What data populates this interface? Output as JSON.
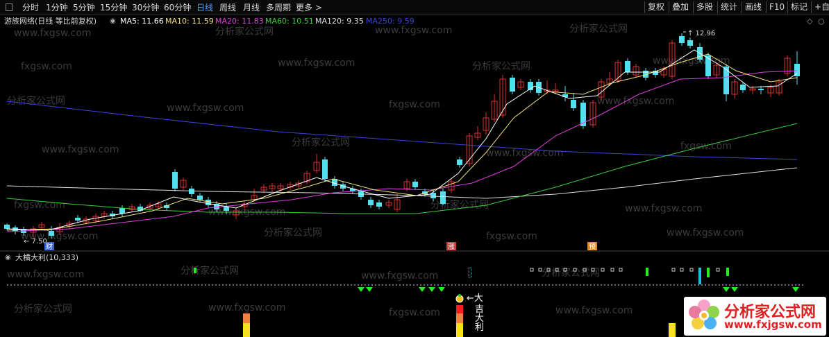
{
  "toolbar": {
    "periods": [
      "分时",
      "1分钟",
      "5分钟",
      "15分钟",
      "30分钟",
      "60分钟",
      "日线",
      "周线",
      "月线",
      "多周期",
      "更多 >"
    ],
    "active_period": "日线",
    "right_buttons": [
      "复权",
      "叠加",
      "多股",
      "统计",
      "画线",
      "F10",
      "标记",
      "+自"
    ]
  },
  "info": {
    "title": "游族网络(日线 等比前复权)",
    "ma": [
      {
        "label": "MA5: 11.66",
        "color": "#ffffff"
      },
      {
        "label": "MA10: 11.59",
        "color": "#f5e27a"
      },
      {
        "label": "MA20: 11.83",
        "color": "#e040e0"
      },
      {
        "label": "MA60: 10.51",
        "color": "#3cd03c"
      },
      {
        "label": "MA120: 9.35",
        "color": "#e0e0e0"
      },
      {
        "label": "MA250: 9.59",
        "color": "#3a44e0"
      }
    ]
  },
  "price_chart": {
    "high_label": "12.96",
    "low_label": "7.50",
    "markers": [
      {
        "text": "财",
        "color": "#3a66d0"
      },
      {
        "text": "涨",
        "color": "#c84040"
      },
      {
        "text": "预",
        "color": "#e08a20"
      }
    ]
  },
  "indicator": {
    "title": "大橘大利(10,333)",
    "signal_text": [
      "←大",
      "吉",
      "大",
      "利"
    ]
  },
  "watermark": {
    "texts": [
      "www.fxgsw.com",
      "分析家公式网",
      "fxgsw.com"
    ]
  },
  "logo": {
    "name": "分析家公式网",
    "url": "www.fxjgsw.com"
  },
  "colors": {
    "up": "#e03030",
    "down": "#52e0f0",
    "ma5": "#ffffff",
    "ma10": "#f5e27a",
    "ma20": "#e040e0",
    "ma60": "#3cd03c",
    "ma120": "#e0e0e0",
    "ma250": "#3a44e0"
  }
}
